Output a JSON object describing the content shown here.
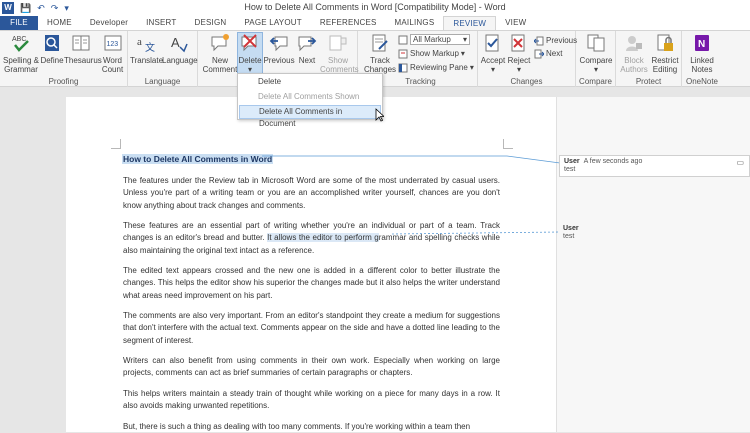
{
  "window": {
    "title": "How to Delete All Comments in Word [Compatibility Mode] - Word"
  },
  "tabs": [
    {
      "label": "FILE"
    },
    {
      "label": "HOME"
    },
    {
      "label": "Developer"
    },
    {
      "label": "INSERT"
    },
    {
      "label": "DESIGN"
    },
    {
      "label": "PAGE LAYOUT"
    },
    {
      "label": "REFERENCES"
    },
    {
      "label": "MAILINGS"
    },
    {
      "label": "REVIEW"
    },
    {
      "label": "VIEW"
    }
  ],
  "ribbon": {
    "proofing": {
      "label": "Proofing",
      "spelling_1": "Spelling &",
      "spelling_2": "Grammar",
      "define": "Define",
      "thesaurus": "Thesaurus",
      "wordcount_1": "Word",
      "wordcount_2": "Count"
    },
    "language": {
      "label": "Language",
      "translate": "Translate",
      "language": "Language"
    },
    "comments": {
      "new_1": "New",
      "new_2": "Comment",
      "delete": "Delete",
      "previous": "Previous",
      "next": "Next",
      "show_1": "Show",
      "show_2": "Comments"
    },
    "tracking": {
      "label": "Tracking",
      "track_1": "Track",
      "track_2": "Changes",
      "markup_select": "All Markup",
      "show_markup": "Show Markup",
      "reviewing_pane": "Reviewing Pane"
    },
    "changes": {
      "label": "Changes",
      "accept": "Accept",
      "reject": "Reject",
      "previous": "Previous",
      "next": "Next"
    },
    "compare": {
      "label": "Compare",
      "compare": "Compare"
    },
    "protect": {
      "label": "Protect",
      "block_1": "Block",
      "block_2": "Authors",
      "restrict_1": "Restrict",
      "restrict_2": "Editing"
    },
    "onenote": {
      "label": "OneNote",
      "linked_1": "Linked",
      "linked_2": "Notes"
    }
  },
  "delete_menu": {
    "items": [
      {
        "label": "Delete"
      },
      {
        "label": "Delete All Comments Shown"
      },
      {
        "label": "Delete All Comments in Document"
      }
    ]
  },
  "document": {
    "heading": "How to Delete All Comments in Word",
    "p1": "The features under the Review tab in Microsoft Word are some of the most underrated by casual users. Unless you're part of a writing team or you are an accomplished writer yourself, chances are you don't know anything about track changes and comments.",
    "p2_a": "These features are an essential part of writing whether you're an individual or part of a team. Track changes is an editor's bread and butter. ",
    "p2_hl": "It allows the editor to perform g",
    "p2_b": "rammar and spelling checks while also maintaining the original text intact as a reference.",
    "p3": "The edited text appears crossed and the new one is added in a different color to better illustrate the changes. This helps the editor show his superior the changes made but it also helps the writer understand what areas need improvement on his part.",
    "p4": "The comments are also very important. From an editor's standpoint they create a medium for suggestions that don't interfere with the actual text. Comments appear on the side and have a dotted line leading to the segment of interest.",
    "p5": "Writers can also benefit from using comments in their own work. Especially when working on large projects, comments can act as brief summaries of certain paragraphs or chapters.",
    "p6": "This helps writers maintain a steady train of thought while working on a piece for many days in a row. It also avoids making unwanted repetitions.",
    "p7": "But, there is such a thing as dealing with too many comments. If you're working within a team then"
  },
  "comments": [
    {
      "author": "User",
      "time": "A few seconds ago",
      "text": "test"
    },
    {
      "author": "User",
      "text": "test"
    }
  ],
  "colors": {
    "accent": "#2b579a",
    "highlight": "#c9def2",
    "comment_line": "#5b9bd5"
  }
}
